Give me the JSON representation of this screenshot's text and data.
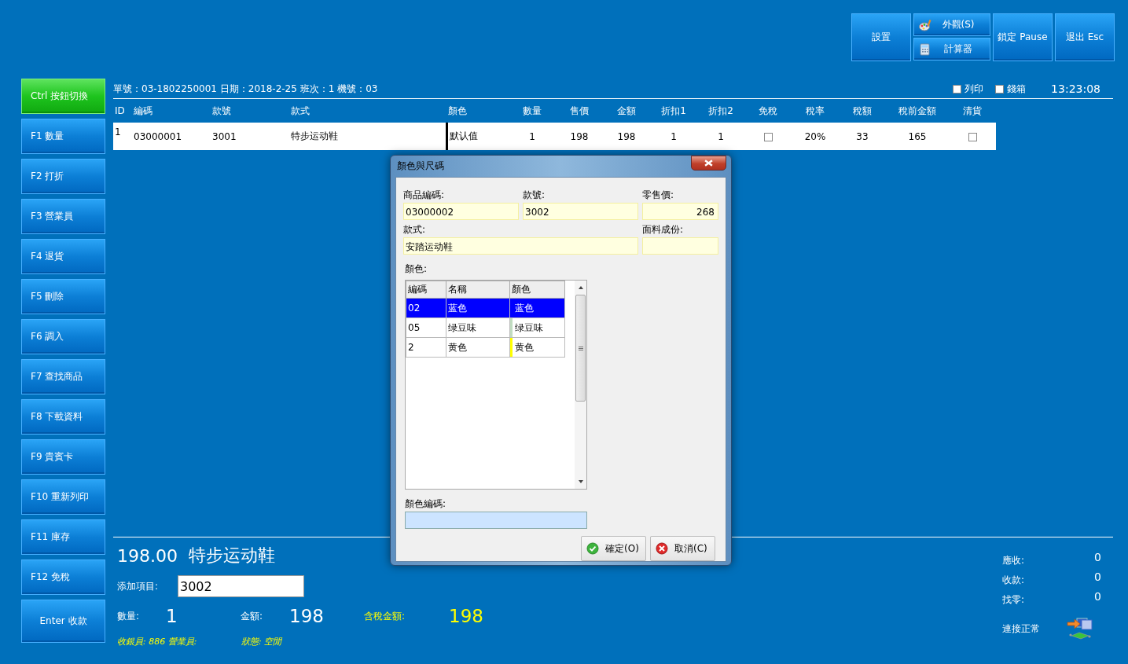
{
  "toolbar": [
    {
      "kind": "button",
      "label": "設置"
    },
    {
      "kind": "stack",
      "buttons": [
        {
          "label": "外觀(S)"
        },
        {
          "label": "計算器"
        }
      ]
    },
    {
      "kind": "button",
      "label": "鎖定 Pause"
    },
    {
      "kind": "button",
      "label": "退出 Esc"
    }
  ],
  "sidebar": [
    {
      "kind": "key",
      "label": "Ctrl 按鈕切換",
      "active": true
    },
    {
      "kind": "key",
      "label": "F1 數量",
      "active": false
    },
    {
      "kind": "key",
      "label": "F2 打折",
      "active": false
    },
    {
      "kind": "key",
      "label": "F3 營業員",
      "active": false
    },
    {
      "kind": "key",
      "label": "F4 退貨",
      "active": false
    },
    {
      "kind": "key",
      "label": "F5 刪除",
      "active": false
    },
    {
      "kind": "key",
      "label": "F6 調入",
      "active": false
    },
    {
      "kind": "key",
      "label": "F7 查找商品",
      "active": false
    },
    {
      "kind": "key",
      "label": "F8 下載資料",
      "active": false
    },
    {
      "kind": "key",
      "label": "F9 貴賓卡",
      "active": false
    },
    {
      "kind": "key",
      "label": "F10 重新列印",
      "active": false
    },
    {
      "kind": "key",
      "label": "F11 庫存",
      "active": false
    },
    {
      "kind": "key",
      "label": "F12 免稅",
      "active": false
    },
    {
      "kind": "checkout",
      "label": "Enter 收款",
      "active": false
    }
  ],
  "order_info": "單號：03-1802250001 日期：2018-2-25 班次：1 機號：03",
  "options": [
    {
      "label": "列印",
      "checked": false
    },
    {
      "label": "錢箱",
      "checked": false
    }
  ],
  "clock": "13:23:08",
  "table": {
    "columns": [
      {
        "label": "ID",
        "kind": "text"
      },
      {
        "label": "編碼",
        "kind": "text"
      },
      {
        "label": "款號",
        "kind": "text"
      },
      {
        "label": "款式",
        "kind": "text"
      },
      {
        "label": "顏色",
        "kind": "text"
      },
      {
        "label": "數量",
        "kind": "text"
      },
      {
        "label": "售價",
        "kind": "text"
      },
      {
        "label": "金額",
        "kind": "text"
      },
      {
        "label": "折扣1",
        "kind": "text"
      },
      {
        "label": "折扣2",
        "kind": "text"
      },
      {
        "label": "免稅",
        "kind": "check"
      },
      {
        "label": "稅率",
        "kind": "text"
      },
      {
        "label": "稅額",
        "kind": "text"
      },
      {
        "label": "稅前金額",
        "kind": "text"
      },
      {
        "label": "清貨",
        "kind": "check"
      }
    ],
    "rows": [
      {
        "cells": [
          "1",
          "03000001",
          "3001",
          "特步运动鞋",
          "默认值",
          "1",
          "198",
          "198",
          "1",
          "1",
          false,
          "20%",
          "33",
          "165",
          false
        ]
      }
    ]
  },
  "current_item": {
    "price": "198.00",
    "name": "特步运动鞋"
  },
  "add_item": {
    "label": "添加項目:",
    "value": "3002"
  },
  "totals": [
    {
      "kind": "normal",
      "label": "數量:",
      "value": "1"
    },
    {
      "kind": "normal",
      "label": "金額:",
      "value": "198"
    },
    {
      "kind": "highlight",
      "label": "含稅金額:",
      "value": "198"
    }
  ],
  "status_line": [
    "收銀員: 886 營業員:",
    "狀態: 空閒"
  ],
  "payment": [
    {
      "label": "應收:",
      "value": "0"
    },
    {
      "label": "收款:",
      "value": "0"
    },
    {
      "label": "找零:",
      "value": "0"
    }
  ],
  "connection": "連接正常",
  "dialog": {
    "title": "顏色與尺碼",
    "fields": [
      {
        "label": "商品編碼:",
        "value": "03000002"
      },
      {
        "label": "款號:",
        "value": "3002"
      },
      {
        "label": "零售價:",
        "value": "268"
      },
      {
        "label": "款式:",
        "value": "安踏运动鞋"
      },
      {
        "label": "面料成份:"
      }
    ],
    "color_label": "顏色:",
    "color_grid": {
      "columns": [
        "編碼",
        "名稱",
        "顏色"
      ],
      "rows": [
        {
          "cells": [
            "02",
            "蓝色",
            "蓝色"
          ],
          "selected": true
        },
        {
          "cells": [
            "05",
            "绿豆味",
            "绿豆味"
          ],
          "color": "#c0dcc0",
          "selected": false
        },
        {
          "cells": [
            "2",
            "黄色",
            "黄色"
          ],
          "color": "#ffff00",
          "selected": false
        }
      ]
    },
    "color_code": {
      "label": "顏色編碼:"
    },
    "buttons": [
      {
        "kind": "ok",
        "label": "確定(O)"
      },
      {
        "kind": "cancel",
        "label": "取消(C)"
      }
    ]
  }
}
